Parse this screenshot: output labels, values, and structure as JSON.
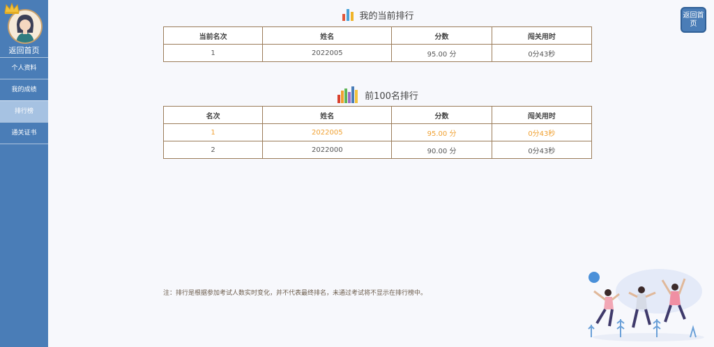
{
  "sidebar": {
    "home_label": "返回首页",
    "items": [
      {
        "label": "个人资料",
        "active": false
      },
      {
        "label": "我的成绩",
        "active": false
      },
      {
        "label": "排行榜",
        "active": true
      },
      {
        "label": "通关证书",
        "active": false
      }
    ]
  },
  "home_button": {
    "label": "返回首页"
  },
  "my_rank": {
    "title": "我的当前排行",
    "headers": [
      "当前名次",
      "姓名",
      "分数",
      "闯关用时"
    ],
    "row": {
      "rank": "1",
      "name": "2022005",
      "score": "95.00 分",
      "time": "0分43秒"
    }
  },
  "top100": {
    "title": "前100名排行",
    "headers": [
      "名次",
      "姓名",
      "分数",
      "闯关用时"
    ],
    "rows": [
      {
        "rank": "1",
        "name": "2022005",
        "score": "95.00 分",
        "time": "0分43秒",
        "highlight": true
      },
      {
        "rank": "2",
        "name": "2022000",
        "score": "90.00 分",
        "time": "0分43秒",
        "highlight": false
      }
    ]
  },
  "note": "注：排行是根据参加考试人数实时变化，并不代表最终排名，未通过考试将不显示在排行榜中。",
  "colors": {
    "sidebar": "#4a7db7",
    "active_item": "#a6c2e2",
    "highlight_text": "#f0a030",
    "border": "#9a7b58"
  }
}
